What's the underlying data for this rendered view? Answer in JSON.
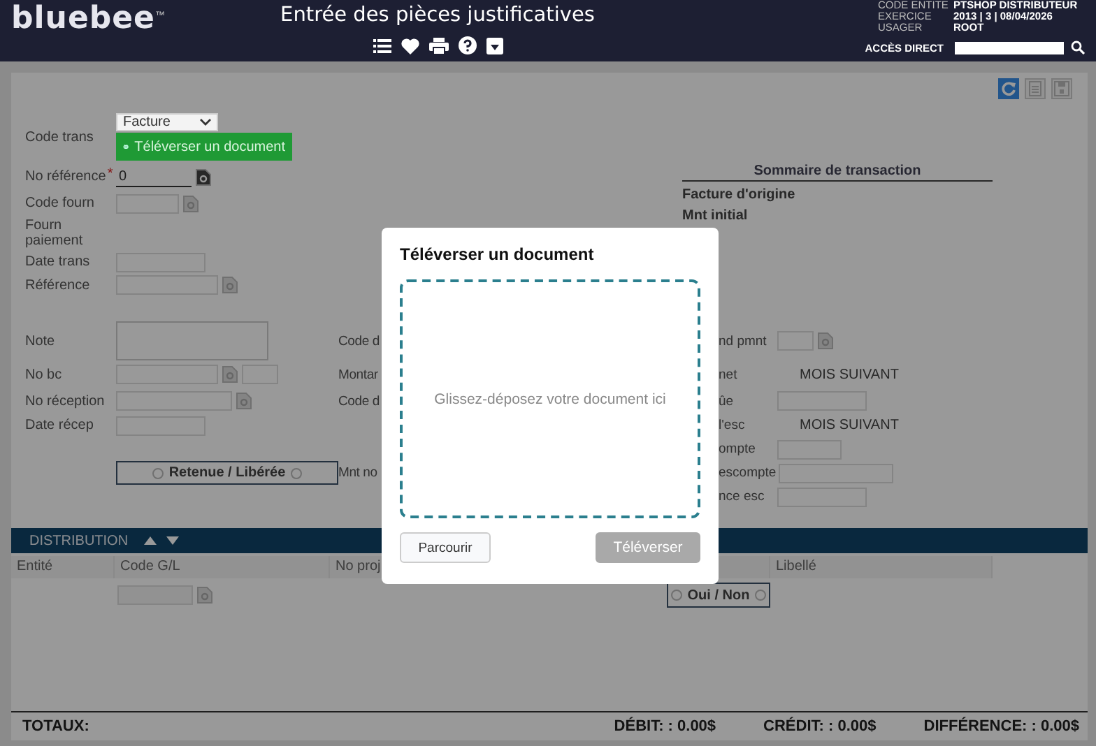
{
  "header": {
    "logo": "bluebee",
    "logo_mark": "™",
    "title": "Entrée des pièces justificatives",
    "info": [
      {
        "label": "CODE ENTITE",
        "value": "PTSHOP DISTRIBUTEUR"
      },
      {
        "label": "EXERCICE",
        "value": "2013 | 3 | 08/04/2026"
      },
      {
        "label": "USAGER",
        "value": "ROOT"
      }
    ],
    "direct_access": {
      "label": "ACCÈS DIRECT"
    }
  },
  "form": {
    "code_trans": {
      "label": "Code trans",
      "value": "Facture"
    },
    "upload_button": "Téléverser un document",
    "required_mark": "*",
    "left_fields": [
      {
        "label": "No référence",
        "kind": "lookup",
        "value": "0",
        "required": true
      },
      {
        "label": "Code fourn",
        "kind": "lookup",
        "required": false
      },
      {
        "label": "Fourn paiement",
        "kind": "empty",
        "required": false
      },
      {
        "label": "Date trans",
        "kind": "text",
        "required": false
      },
      {
        "label": "Référence",
        "kind": "lookup",
        "required": false
      },
      {
        "label": "Note",
        "kind": "textarea",
        "required": false
      },
      {
        "label": "No bc",
        "kind": "lookup_pair",
        "required": false
      },
      {
        "label": "No réception",
        "kind": "lookup",
        "required": false
      },
      {
        "label": "Date récep",
        "kind": "text",
        "required": false
      }
    ],
    "toggle": {
      "label": "Retenue / Libérée",
      "left_checked": false,
      "right_checked": false
    },
    "middle_labels": [
      "Code d",
      "Montar",
      "Code d",
      "Mnt no"
    ],
    "summary": {
      "title": "Sommaire de transaction",
      "lines": [
        "Facture d'origine",
        "Mnt initial"
      ]
    },
    "right_fields": [
      {
        "label": "nd pmnt",
        "kind": "lookup"
      },
      {
        "label": "net",
        "kind": "value",
        "value": "MOIS SUIVANT"
      },
      {
        "label": "ûe",
        "kind": "text"
      },
      {
        "label": "l'esc",
        "kind": "value",
        "value": "MOIS SUIVANT"
      },
      {
        "label": "ompte",
        "kind": "text"
      },
      {
        "label": "escompte",
        "kind": "text"
      },
      {
        "label": "nce esc",
        "kind": "text"
      }
    ]
  },
  "distribution": {
    "title": "DISTRIBUTION",
    "columns": [
      "Entité",
      "Code G/L",
      "No proj",
      "Libellé"
    ],
    "toggle": {
      "label": "Oui / Non",
      "left_checked": false,
      "right_checked": false
    }
  },
  "totals": {
    "label": "TOTAUX:",
    "debit": "DÉBIT: : 0.00$",
    "credit": "CRÉDIT: : 0.00$",
    "difference": "DIFFÉRENCE: : 0.00$"
  },
  "modal": {
    "title": "Téléverser un document",
    "dropzone": "Glissez-déposez votre document ici",
    "browse_button": "Parcourir",
    "upload_button": {
      "label": "Téléverser",
      "disabled": true
    }
  }
}
